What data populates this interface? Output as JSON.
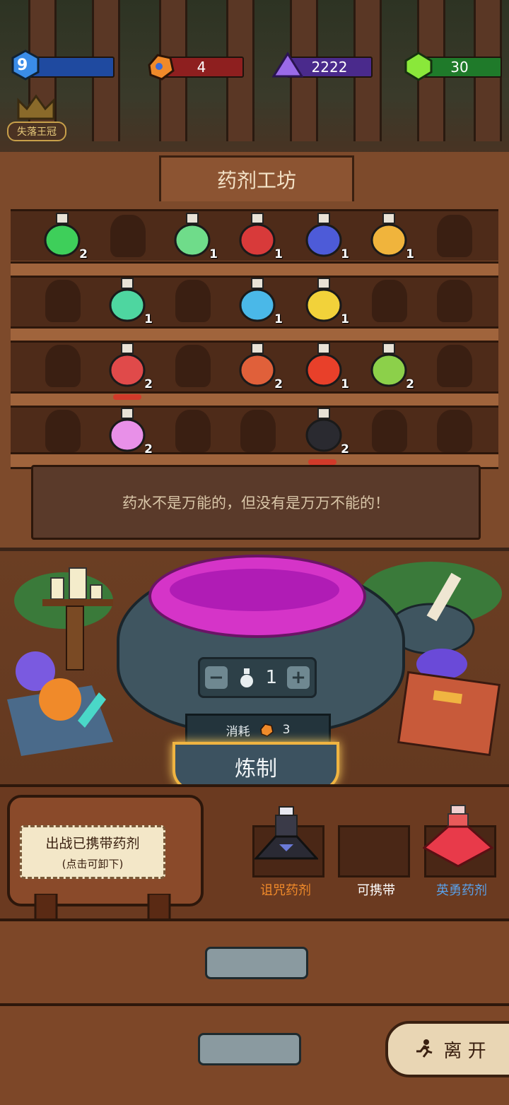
{
  "hud": {
    "level": "9",
    "resources": [
      {
        "name": "ore",
        "value": "4",
        "color": "#8e1f1f",
        "icon": "ore-icon"
      },
      {
        "name": "crystal",
        "value": "2222",
        "color": "#4a2a8c",
        "icon": "purple-crystal-icon"
      },
      {
        "name": "gem",
        "value": "30",
        "color": "#1f7a2a",
        "icon": "green-gem-icon"
      }
    ],
    "crown_badge": "失落王冠"
  },
  "workshop": {
    "title": "药剂工坊",
    "shelves": [
      [
        {
          "color": "#3ecf5a",
          "count": "2"
        },
        null,
        {
          "color": "#6fdc8a",
          "count": "1"
        },
        {
          "color": "#d83a3a",
          "count": "1"
        },
        {
          "color": "#4d5bd8",
          "count": "1"
        },
        {
          "color": "#f0b43c",
          "count": "1"
        },
        null
      ],
      [
        null,
        {
          "color": "#4ed6a0",
          "count": "1"
        },
        null,
        {
          "color": "#4ab8e8",
          "count": "1"
        },
        {
          "color": "#f2d23a",
          "count": "1"
        },
        null,
        null
      ],
      [
        null,
        {
          "color": "#e04a4a",
          "count": "2"
        },
        null,
        {
          "color": "#e0603a",
          "count": "2"
        },
        {
          "color": "#e8402a",
          "count": "1"
        },
        {
          "color": "#8cd04a",
          "count": "2"
        },
        null
      ],
      [
        null,
        {
          "color": "#e890e8",
          "count": "2"
        },
        null,
        null,
        {
          "color": "#2a2a30",
          "count": "2"
        },
        null,
        null
      ]
    ],
    "message": "药水不是万能的，但没有是万万不能的！"
  },
  "brew": {
    "quantity": "1",
    "cost_label": "消耗",
    "cost_value": "3",
    "brew_button": "炼制"
  },
  "carry": {
    "label": "出战已携带药剂",
    "hint": "(点击可卸下)",
    "slots": [
      {
        "label": "诅咒药剂",
        "color": "#f08a2a"
      },
      {
        "label": "可携带",
        "color": "#ffffff"
      },
      {
        "label": "英勇药剂",
        "color": "#5aa0e8"
      }
    ]
  },
  "leave_button": "离 开"
}
